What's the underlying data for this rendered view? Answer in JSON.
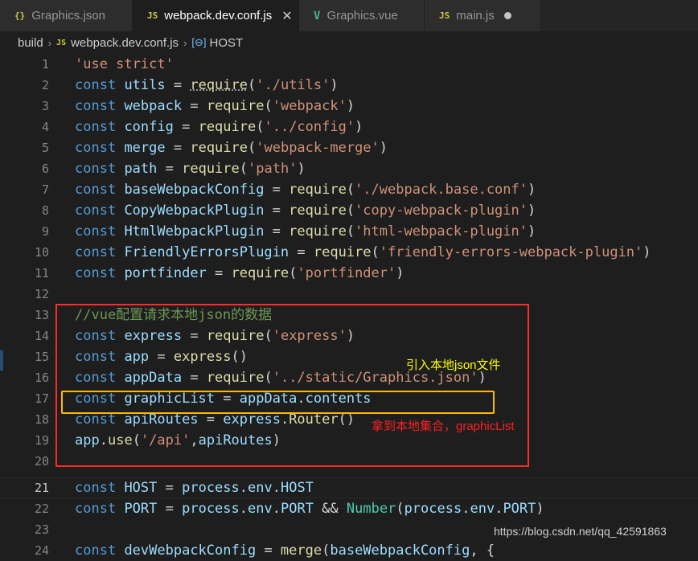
{
  "tabs": [
    {
      "icon": "{}",
      "label": "Graphics.json",
      "state": "inactive"
    },
    {
      "icon": "JS",
      "label": "webpack.dev.conf.js",
      "state": "active",
      "close": "✕"
    },
    {
      "icon": "V",
      "label": "Graphics.vue",
      "state": "inactive"
    },
    {
      "icon": "JS",
      "label": "main.js",
      "state": "modified"
    }
  ],
  "breadcrumb": {
    "folder": "build",
    "file_icon": "JS",
    "file": "webpack.dev.conf.js",
    "symbol_icon": "[⊖]",
    "symbol": "HOST",
    "sep": "›"
  },
  "lines": [
    "1",
    "2",
    "3",
    "4",
    "5",
    "6",
    "7",
    "8",
    "9",
    "10",
    "11",
    "12",
    "13",
    "14",
    "15",
    "16",
    "17",
    "18",
    "19",
    "20",
    "21",
    "22",
    "23",
    "24"
  ],
  "annotations": {
    "import_note": "引入本地json文件",
    "collection_note": "拿到本地集合，graphicList"
  },
  "watermark": "https://blog.csdn.net/qq_42591863",
  "colors": {
    "keyword": "#569cd6",
    "variable": "#9cdcfe",
    "function": "#dcdcaa",
    "string": "#ce9178",
    "comment": "#6a9955",
    "red_box": "#ff2a2a",
    "yellow_box": "#ffbb00"
  }
}
